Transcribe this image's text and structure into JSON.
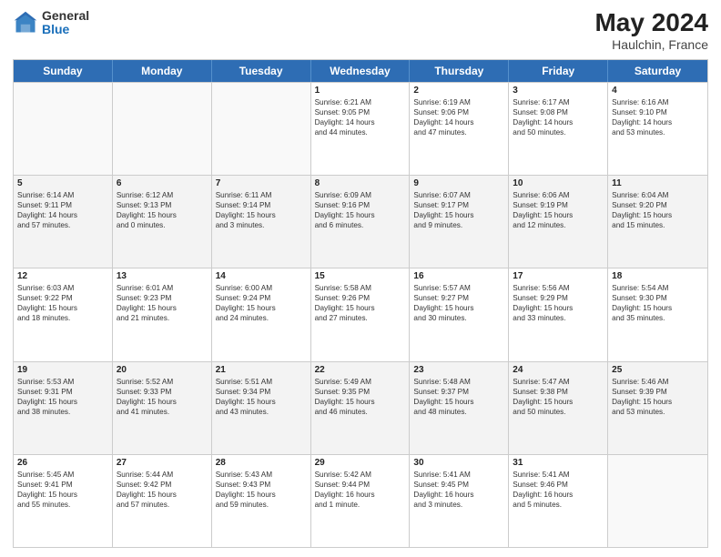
{
  "header": {
    "logo_general": "General",
    "logo_blue": "Blue",
    "title": "May 2024",
    "location": "Haulchin, France"
  },
  "days_of_week": [
    "Sunday",
    "Monday",
    "Tuesday",
    "Wednesday",
    "Thursday",
    "Friday",
    "Saturday"
  ],
  "weeks": [
    [
      {
        "day": "",
        "info": "",
        "empty": true
      },
      {
        "day": "",
        "info": "",
        "empty": true
      },
      {
        "day": "",
        "info": "",
        "empty": true
      },
      {
        "day": "1",
        "info": "Sunrise: 6:21 AM\nSunset: 9:05 PM\nDaylight: 14 hours\nand 44 minutes."
      },
      {
        "day": "2",
        "info": "Sunrise: 6:19 AM\nSunset: 9:06 PM\nDaylight: 14 hours\nand 47 minutes."
      },
      {
        "day": "3",
        "info": "Sunrise: 6:17 AM\nSunset: 9:08 PM\nDaylight: 14 hours\nand 50 minutes."
      },
      {
        "day": "4",
        "info": "Sunrise: 6:16 AM\nSunset: 9:10 PM\nDaylight: 14 hours\nand 53 minutes."
      }
    ],
    [
      {
        "day": "5",
        "info": "Sunrise: 6:14 AM\nSunset: 9:11 PM\nDaylight: 14 hours\nand 57 minutes."
      },
      {
        "day": "6",
        "info": "Sunrise: 6:12 AM\nSunset: 9:13 PM\nDaylight: 15 hours\nand 0 minutes."
      },
      {
        "day": "7",
        "info": "Sunrise: 6:11 AM\nSunset: 9:14 PM\nDaylight: 15 hours\nand 3 minutes."
      },
      {
        "day": "8",
        "info": "Sunrise: 6:09 AM\nSunset: 9:16 PM\nDaylight: 15 hours\nand 6 minutes."
      },
      {
        "day": "9",
        "info": "Sunrise: 6:07 AM\nSunset: 9:17 PM\nDaylight: 15 hours\nand 9 minutes."
      },
      {
        "day": "10",
        "info": "Sunrise: 6:06 AM\nSunset: 9:19 PM\nDaylight: 15 hours\nand 12 minutes."
      },
      {
        "day": "11",
        "info": "Sunrise: 6:04 AM\nSunset: 9:20 PM\nDaylight: 15 hours\nand 15 minutes."
      }
    ],
    [
      {
        "day": "12",
        "info": "Sunrise: 6:03 AM\nSunset: 9:22 PM\nDaylight: 15 hours\nand 18 minutes."
      },
      {
        "day": "13",
        "info": "Sunrise: 6:01 AM\nSunset: 9:23 PM\nDaylight: 15 hours\nand 21 minutes."
      },
      {
        "day": "14",
        "info": "Sunrise: 6:00 AM\nSunset: 9:24 PM\nDaylight: 15 hours\nand 24 minutes."
      },
      {
        "day": "15",
        "info": "Sunrise: 5:58 AM\nSunset: 9:26 PM\nDaylight: 15 hours\nand 27 minutes."
      },
      {
        "day": "16",
        "info": "Sunrise: 5:57 AM\nSunset: 9:27 PM\nDaylight: 15 hours\nand 30 minutes."
      },
      {
        "day": "17",
        "info": "Sunrise: 5:56 AM\nSunset: 9:29 PM\nDaylight: 15 hours\nand 33 minutes."
      },
      {
        "day": "18",
        "info": "Sunrise: 5:54 AM\nSunset: 9:30 PM\nDaylight: 15 hours\nand 35 minutes."
      }
    ],
    [
      {
        "day": "19",
        "info": "Sunrise: 5:53 AM\nSunset: 9:31 PM\nDaylight: 15 hours\nand 38 minutes."
      },
      {
        "day": "20",
        "info": "Sunrise: 5:52 AM\nSunset: 9:33 PM\nDaylight: 15 hours\nand 41 minutes."
      },
      {
        "day": "21",
        "info": "Sunrise: 5:51 AM\nSunset: 9:34 PM\nDaylight: 15 hours\nand 43 minutes."
      },
      {
        "day": "22",
        "info": "Sunrise: 5:49 AM\nSunset: 9:35 PM\nDaylight: 15 hours\nand 46 minutes."
      },
      {
        "day": "23",
        "info": "Sunrise: 5:48 AM\nSunset: 9:37 PM\nDaylight: 15 hours\nand 48 minutes."
      },
      {
        "day": "24",
        "info": "Sunrise: 5:47 AM\nSunset: 9:38 PM\nDaylight: 15 hours\nand 50 minutes."
      },
      {
        "day": "25",
        "info": "Sunrise: 5:46 AM\nSunset: 9:39 PM\nDaylight: 15 hours\nand 53 minutes."
      }
    ],
    [
      {
        "day": "26",
        "info": "Sunrise: 5:45 AM\nSunset: 9:41 PM\nDaylight: 15 hours\nand 55 minutes."
      },
      {
        "day": "27",
        "info": "Sunrise: 5:44 AM\nSunset: 9:42 PM\nDaylight: 15 hours\nand 57 minutes."
      },
      {
        "day": "28",
        "info": "Sunrise: 5:43 AM\nSunset: 9:43 PM\nDaylight: 15 hours\nand 59 minutes."
      },
      {
        "day": "29",
        "info": "Sunrise: 5:42 AM\nSunset: 9:44 PM\nDaylight: 16 hours\nand 1 minute."
      },
      {
        "day": "30",
        "info": "Sunrise: 5:41 AM\nSunset: 9:45 PM\nDaylight: 16 hours\nand 3 minutes."
      },
      {
        "day": "31",
        "info": "Sunrise: 5:41 AM\nSunset: 9:46 PM\nDaylight: 16 hours\nand 5 minutes."
      },
      {
        "day": "",
        "info": "",
        "empty": true
      }
    ]
  ]
}
